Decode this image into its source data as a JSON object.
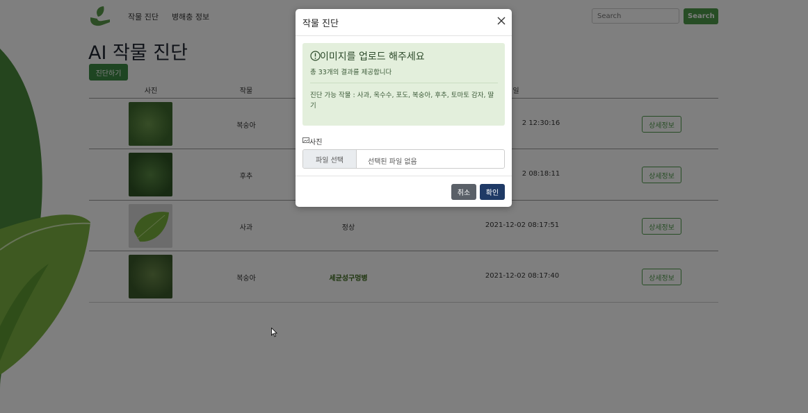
{
  "navbar": {
    "links": [
      "작물 진단",
      "병해충 정보"
    ],
    "search_placeholder": "Search",
    "search_button": "Search"
  },
  "page": {
    "title": "AI 작물 진단",
    "diagnose_button": "진단하기"
  },
  "table": {
    "headers": [
      "사진",
      "작물",
      "",
      "일"
    ],
    "rows": [
      {
        "crop": "복숭아",
        "diagnosis": "",
        "date": "2 12:30:16",
        "button": "상세정보",
        "thumb_color": "#4e7a3a"
      },
      {
        "crop": "후추",
        "diagnosis": "",
        "date": "2 08:18:11",
        "button": "상세정보",
        "thumb_color": "#3f6b33"
      },
      {
        "crop": "사과",
        "diagnosis": "정상",
        "date": "2021-12-02 08:17:51",
        "button": "상세정보",
        "thumb_color": "#6ea53d"
      },
      {
        "crop": "복숭아",
        "diagnosis": "세균성구멍병",
        "date": "2021-12-02 08:17:40",
        "button": "상세정보",
        "thumb_color": "#4a6b3a"
      }
    ]
  },
  "modal": {
    "title": "작물 진단",
    "alert_heading": "이미지를 업로드 해주세요",
    "alert_sub": "총 33개의 결과를 제공합니다",
    "alert_crops": "진단 가능 작물 : 사과, 옥수수, 포도, 복숭아, 후추, 토마토 감자, 딸기",
    "photo_label": "사진",
    "file_choose": "파일 선택",
    "file_none": "선택된 파일 없음",
    "cancel": "취소",
    "confirm": "확인"
  },
  "colors": {
    "accent": "#4e9a4a",
    "primary": "#1f3a66",
    "alert_bg": "#e3efdc"
  }
}
